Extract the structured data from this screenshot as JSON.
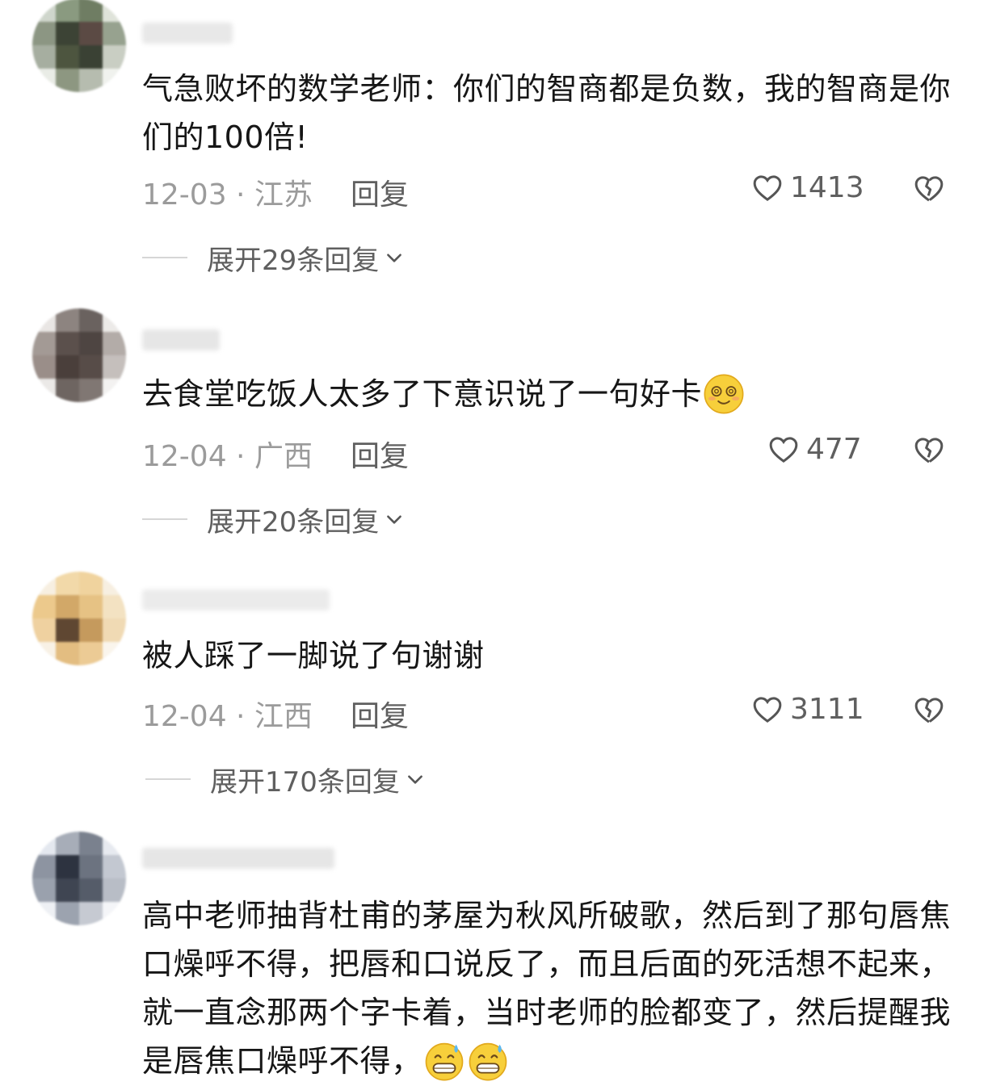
{
  "comments": [
    {
      "text": "气急败坏的数学老师：你们的智商都是负数，我的智商是你们的100倍!",
      "date": "12-03 · 江苏",
      "reply": "回复",
      "likes": "1413",
      "expand": "展开29条回复",
      "avatar_colors": [
        "#cfd6cc",
        "#8a9a80",
        "#6f7d63",
        "#dfe3da",
        "#8c9683",
        "#3c4335",
        "#5b4a44",
        "#97a28f",
        "#a6aea0",
        "#4d553f",
        "#3a4134",
        "#c9cec3",
        "#e9ece6",
        "#8d9781",
        "#b6bcaf",
        "#f0f2ee"
      ],
      "username_color": "#e8e8e8"
    },
    {
      "text": "去食堂吃饭人太多了下意识说了一句好卡",
      "emojis": [
        "dizzy-smile-emoji"
      ],
      "date": "12-04 · 广西",
      "reply": "回复",
      "likes": "477",
      "expand": "展开20条回复",
      "avatar_colors": [
        "#e9e6e4",
        "#8d8480",
        "#6a625f",
        "#eceae8",
        "#a39a95",
        "#5b504c",
        "#4e4542",
        "#b3aca8",
        "#9a8e89",
        "#4a3f3b",
        "#574c48",
        "#c5bfbc",
        "#ebe9e7",
        "#6e6561",
        "#807773",
        "#f3f2f1"
      ],
      "username_color": "#e6e6e6"
    },
    {
      "text": "被人踩了一脚说了句谢谢",
      "date": "12-04 · 江西",
      "reply": "回复",
      "likes": "3111",
      "expand": "展开170条回复",
      "avatar_colors": [
        "#f7efe1",
        "#f2d9a9",
        "#f0d39e",
        "#f7efe1",
        "#ecc98c",
        "#d2a868",
        "#e6c284",
        "#f3e2c2",
        "#efd1a0",
        "#5f4732",
        "#c59a5d",
        "#f0dab4",
        "#f8f1e5",
        "#e3bd81",
        "#eccb95",
        "#faf5ec"
      ],
      "username_color": "#ebebeb"
    },
    {
      "text": "高中老师抽背杜甫的茅屋为秋风所破歌，然后到了那句唇焦口燥呼不得，把唇和口说反了，而且后面的死活想不起来，就一直念那两个字卡着，当时老师的脸都变了，然后提醒我是唇焦口燥呼不得，",
      "emojis": [
        "grin-sweat-emoji",
        "grin-sweat-emoji"
      ],
      "avatar_colors": [
        "#e4e8ef",
        "#a7adb8",
        "#7a818e",
        "#e7eaf0",
        "#8d94a1",
        "#2d3340",
        "#6c7380",
        "#c3c8d1",
        "#9aa1ad",
        "#3f4552",
        "#555c69",
        "#b8bdc6",
        "#eef0f4",
        "#9ca3af",
        "#c6cad2",
        "#f4f5f8"
      ],
      "username_color": "#e6e6e6"
    }
  ],
  "accent_colors": {
    "meta_gray": "#9b9b9b",
    "action_gray": "#5f5f5f",
    "text": "#161616"
  }
}
